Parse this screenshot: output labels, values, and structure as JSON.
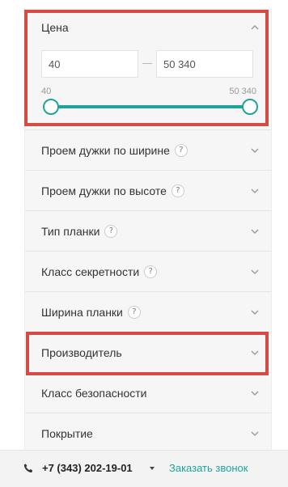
{
  "price": {
    "title": "Цена",
    "from_value": "40",
    "to_value": "50 340",
    "range_min_label": "40",
    "range_max_label": "50 340",
    "slider_low_fraction": 0.0,
    "slider_high_fraction": 1.0,
    "expanded": true
  },
  "filters": [
    {
      "label": "Проем дужки по ширине",
      "has_help": true,
      "help_text": "?"
    },
    {
      "label": "Проем дужки по высоте",
      "has_help": true,
      "help_text": "?"
    },
    {
      "label": "Тип планки",
      "has_help": true,
      "help_text": "?"
    },
    {
      "label": "Класс секретности",
      "has_help": true,
      "help_text": "?"
    },
    {
      "label": "Ширина планки",
      "has_help": true,
      "help_text": "?"
    },
    {
      "label": "Производитель",
      "has_help": false,
      "help_text": ""
    },
    {
      "label": "Класс безопасности",
      "has_help": false,
      "help_text": ""
    },
    {
      "label": "Покрытие",
      "has_help": false,
      "help_text": ""
    }
  ],
  "footer": {
    "phone": "+7 (343) 202-19-01",
    "callback_label": "Заказать звонок",
    "phone_icon": "phone-icon",
    "dropdown_icon": "caret-down-icon"
  },
  "colors": {
    "accent": "#1fa39a",
    "highlight": "#d54a42",
    "panel": "#f6f6f6"
  }
}
